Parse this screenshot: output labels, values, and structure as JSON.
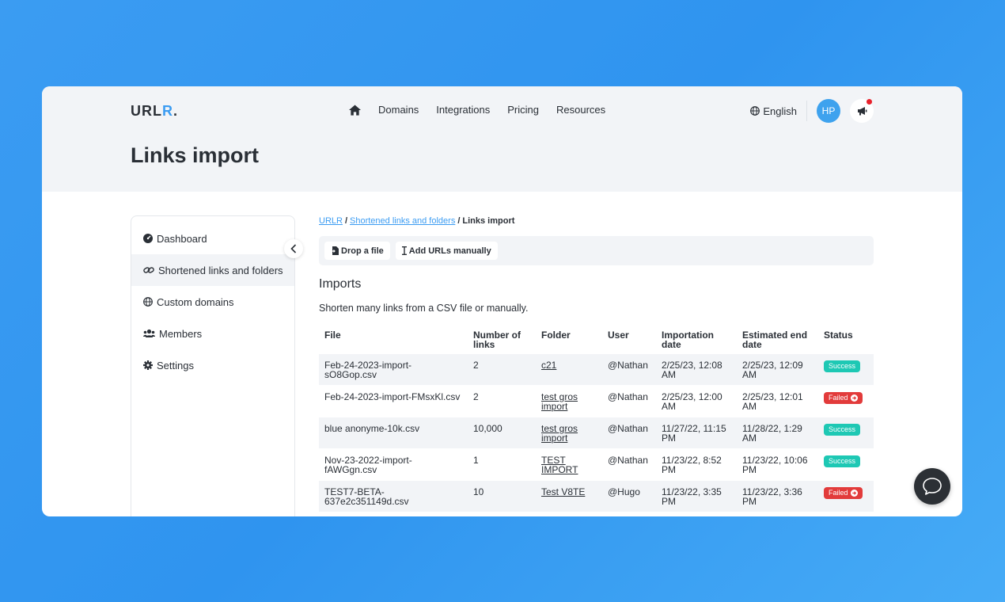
{
  "app": {
    "logo_main": "URL",
    "logo_accent": "R",
    "logo_dot": "."
  },
  "nav": {
    "items": [
      "Domains",
      "Integrations",
      "Pricing",
      "Resources"
    ],
    "language": "English",
    "avatar_initials": "HP"
  },
  "page": {
    "title": "Links import"
  },
  "sidebar": {
    "items": [
      {
        "label": "Dashboard",
        "icon": "dashboard-icon"
      },
      {
        "label": "Shortened links and folders",
        "icon": "link-icon",
        "active": true
      },
      {
        "label": "Custom domains",
        "icon": "globe-icon"
      },
      {
        "label": "Members",
        "icon": "users-icon"
      },
      {
        "label": "Settings",
        "icon": "gear-icon"
      }
    ]
  },
  "breadcrumb": {
    "root": "URLR",
    "parent": "Shortened links and folders",
    "current": "Links import"
  },
  "toolbar": {
    "drop_file": "Drop a file",
    "add_manual": "Add URLs manually"
  },
  "imports": {
    "title": "Imports",
    "description": "Shorten many links from a CSV file or manually.",
    "columns": [
      "File",
      "Number of links",
      "Folder",
      "User",
      "Importation date",
      "Estimated end date",
      "Status"
    ],
    "rows": [
      {
        "file": "Feb-24-2023-import-sO8Gop.csv",
        "links": "2",
        "folder": "c21",
        "user": "@Nathan",
        "import_date": "2/25/23, 12:08 AM",
        "end_date": "2/25/23, 12:09 AM",
        "status": "Success"
      },
      {
        "file": "Feb-24-2023-import-FMsxKl.csv",
        "links": "2",
        "folder": "test gros import",
        "user": "@Nathan",
        "import_date": "2/25/23, 12:00 AM",
        "end_date": "2/25/23, 12:01 AM",
        "status": "Failed"
      },
      {
        "file": "blue anonyme-10k.csv",
        "links": "10,000",
        "folder": "test gros import",
        "user": "@Nathan",
        "import_date": "11/27/22, 11:15 PM",
        "end_date": "11/28/22, 1:29 AM",
        "status": "Success"
      },
      {
        "file": "Nov-23-2022-import-fAWGgn.csv",
        "links": "1",
        "folder": "TEST IMPORT",
        "user": "@Nathan",
        "import_date": "11/23/22, 8:52 PM",
        "end_date": "11/23/22, 10:06 PM",
        "status": "Success"
      },
      {
        "file": "TEST7-BETA-637e2c351149d.csv",
        "links": "10",
        "folder": "Test V8TE",
        "user": "@Hugo",
        "import_date": "11/23/22, 3:35 PM",
        "end_date": "11/23/22, 3:36 PM",
        "status": "Failed"
      }
    ]
  },
  "colors": {
    "accent": "#3b9cf2",
    "success": "#1ec8b4",
    "failed": "#e23b3b"
  }
}
